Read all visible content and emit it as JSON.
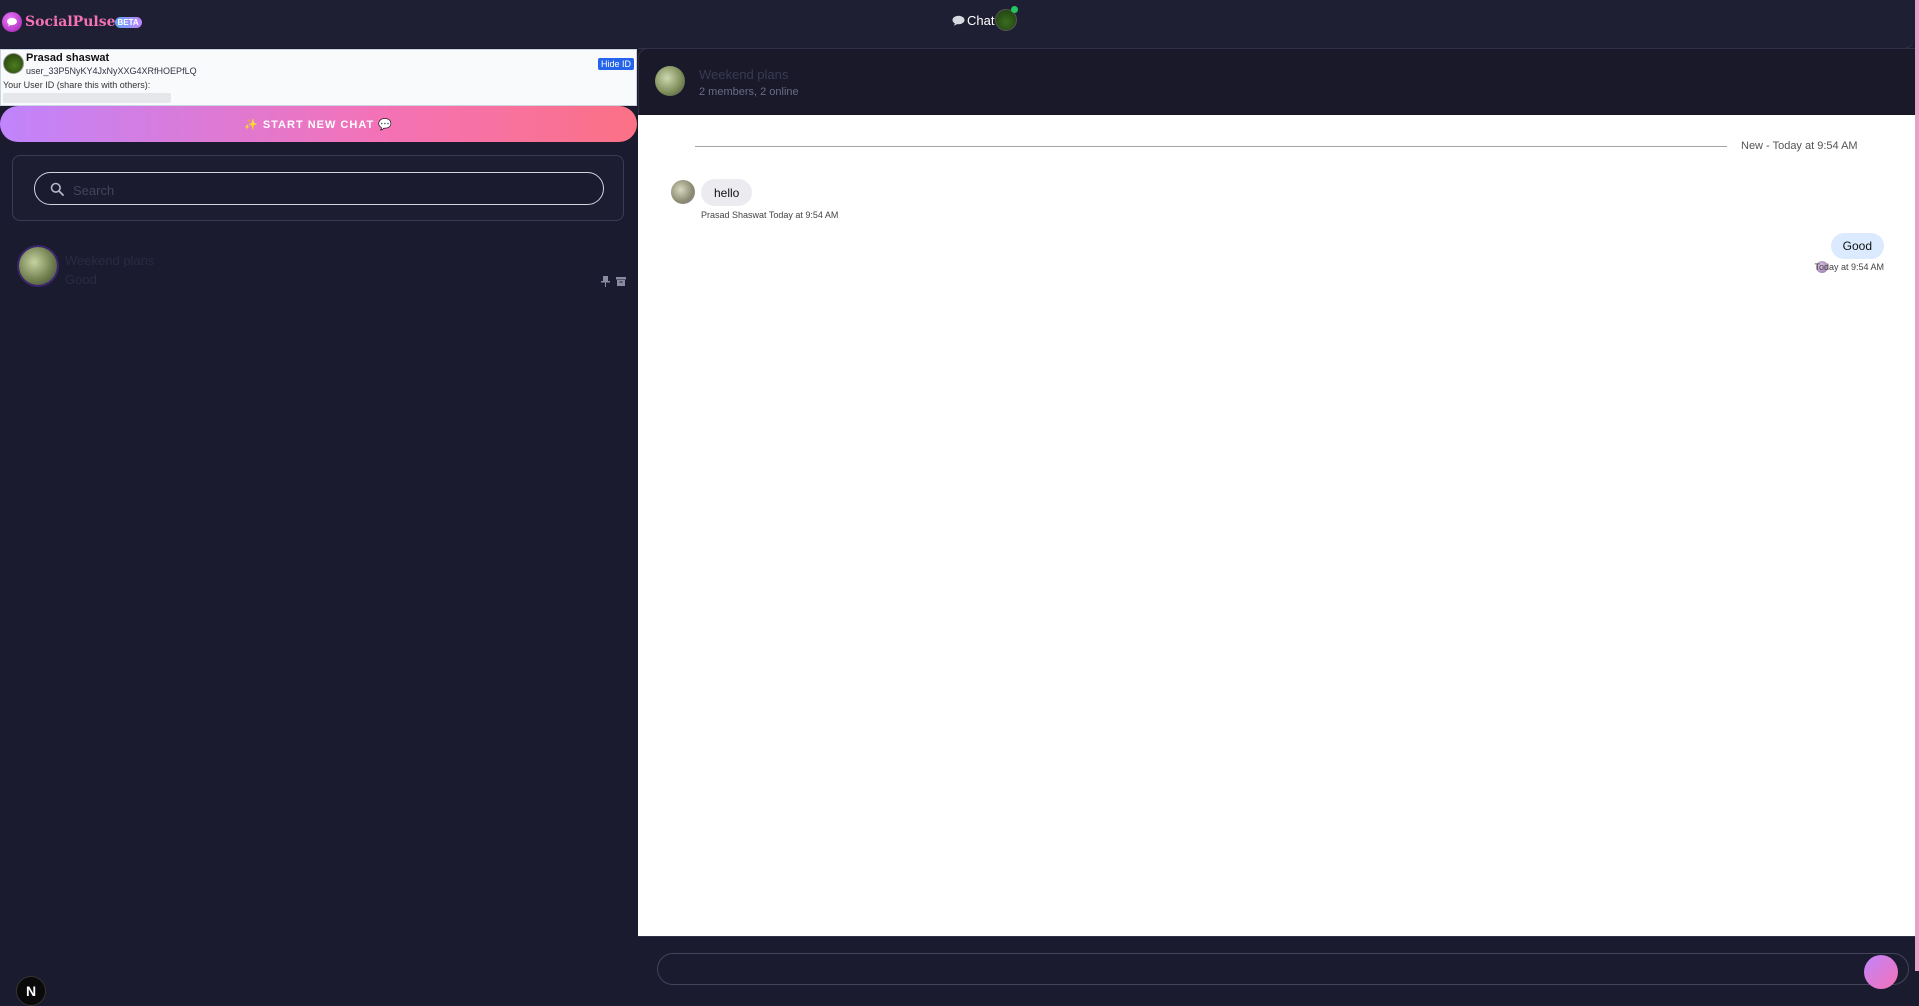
{
  "brand": {
    "name": "SocialPulse",
    "badge": "BETA"
  },
  "nav": {
    "chat_label": "Chat"
  },
  "profile": {
    "name": "Prasad shaswat",
    "user_id": "user_33P5NyKY4JxNyXXG4XRfHOEPfLQ",
    "hide_id_label": "Hide ID",
    "share_label": "Your User ID (share this with others):"
  },
  "sidebar": {
    "new_chat_label": "✨ START NEW CHAT 💬",
    "search_placeholder": "Search",
    "conversations": [
      {
        "name": "Weekend plans",
        "last_message": "Good"
      }
    ]
  },
  "chat": {
    "title": "Weekend plans",
    "subtitle": "2 members, 2 online",
    "divider": "New - Today at 9:54 AM",
    "messages": [
      {
        "direction": "incoming",
        "text": "hello",
        "meta": "Prasad Shaswat Today at 9:54 AM"
      },
      {
        "direction": "outgoing",
        "text": "Good",
        "meta": "Today at 9:54 AM"
      }
    ]
  },
  "badge_letter": "N",
  "colors": {
    "accent_pink": "#f472b6",
    "accent_purple": "#c084fc",
    "background": "#1b1b2f",
    "online": "#22c55e",
    "link_blue": "#2563eb"
  }
}
